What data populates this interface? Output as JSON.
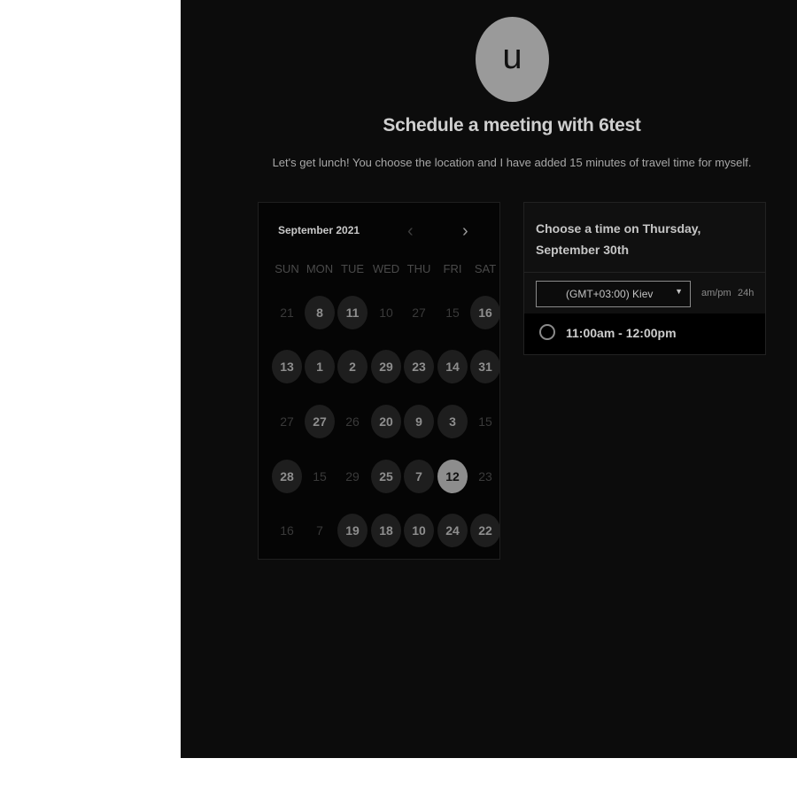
{
  "avatar": {
    "letter": "u"
  },
  "title": "Schedule a meeting with 6test",
  "subtitle": "Let's get lunch! You choose the location and I have added 15 minutes of travel time for myself.",
  "calendar": {
    "month_label": "September 2021",
    "prev_icon": "chevron-left-icon",
    "next_icon": "chevron-right-icon",
    "weekdays": [
      "SUN",
      "MON",
      "TUE",
      "WED",
      "THU",
      "FRI",
      "SAT"
    ],
    "weeks": [
      [
        {
          "d": "21",
          "s": "off"
        },
        {
          "d": "8",
          "s": "avail"
        },
        {
          "d": "11",
          "s": "avail"
        },
        {
          "d": "10",
          "s": "off"
        },
        {
          "d": "27",
          "s": "off"
        },
        {
          "d": "15",
          "s": "off"
        },
        {
          "d": "16",
          "s": "avail"
        }
      ],
      [
        {
          "d": "13",
          "s": "avail"
        },
        {
          "d": "1",
          "s": "avail"
        },
        {
          "d": "2",
          "s": "avail"
        },
        {
          "d": "29",
          "s": "avail"
        },
        {
          "d": "23",
          "s": "avail"
        },
        {
          "d": "14",
          "s": "avail"
        },
        {
          "d": "31",
          "s": "avail"
        }
      ],
      [
        {
          "d": "27",
          "s": "off"
        },
        {
          "d": "27",
          "s": "avail"
        },
        {
          "d": "26",
          "s": "off"
        },
        {
          "d": "20",
          "s": "avail"
        },
        {
          "d": "9",
          "s": "avail"
        },
        {
          "d": "3",
          "s": "avail"
        },
        {
          "d": "15",
          "s": "off"
        }
      ],
      [
        {
          "d": "28",
          "s": "avail"
        },
        {
          "d": "15",
          "s": "off"
        },
        {
          "d": "29",
          "s": "off"
        },
        {
          "d": "25",
          "s": "avail"
        },
        {
          "d": "7",
          "s": "avail"
        },
        {
          "d": "12",
          "s": "sel"
        },
        {
          "d": "23",
          "s": "off"
        }
      ],
      [
        {
          "d": "16",
          "s": "off"
        },
        {
          "d": "7",
          "s": "off"
        },
        {
          "d": "19",
          "s": "avail"
        },
        {
          "d": "18",
          "s": "avail"
        },
        {
          "d": "10",
          "s": "avail"
        },
        {
          "d": "24",
          "s": "avail"
        },
        {
          "d": "22",
          "s": "avail"
        }
      ]
    ]
  },
  "times": {
    "heading": "Choose a time on Thursday, September 30th",
    "timezone": "(GMT+03:00) Kiev",
    "caret_icon": "caret-down-icon",
    "format_ampm": "am/pm",
    "format_24h": "24h",
    "slots": [
      {
        "label": "11:00am - 12:00pm",
        "icon": "radio-circle-icon"
      }
    ]
  }
}
